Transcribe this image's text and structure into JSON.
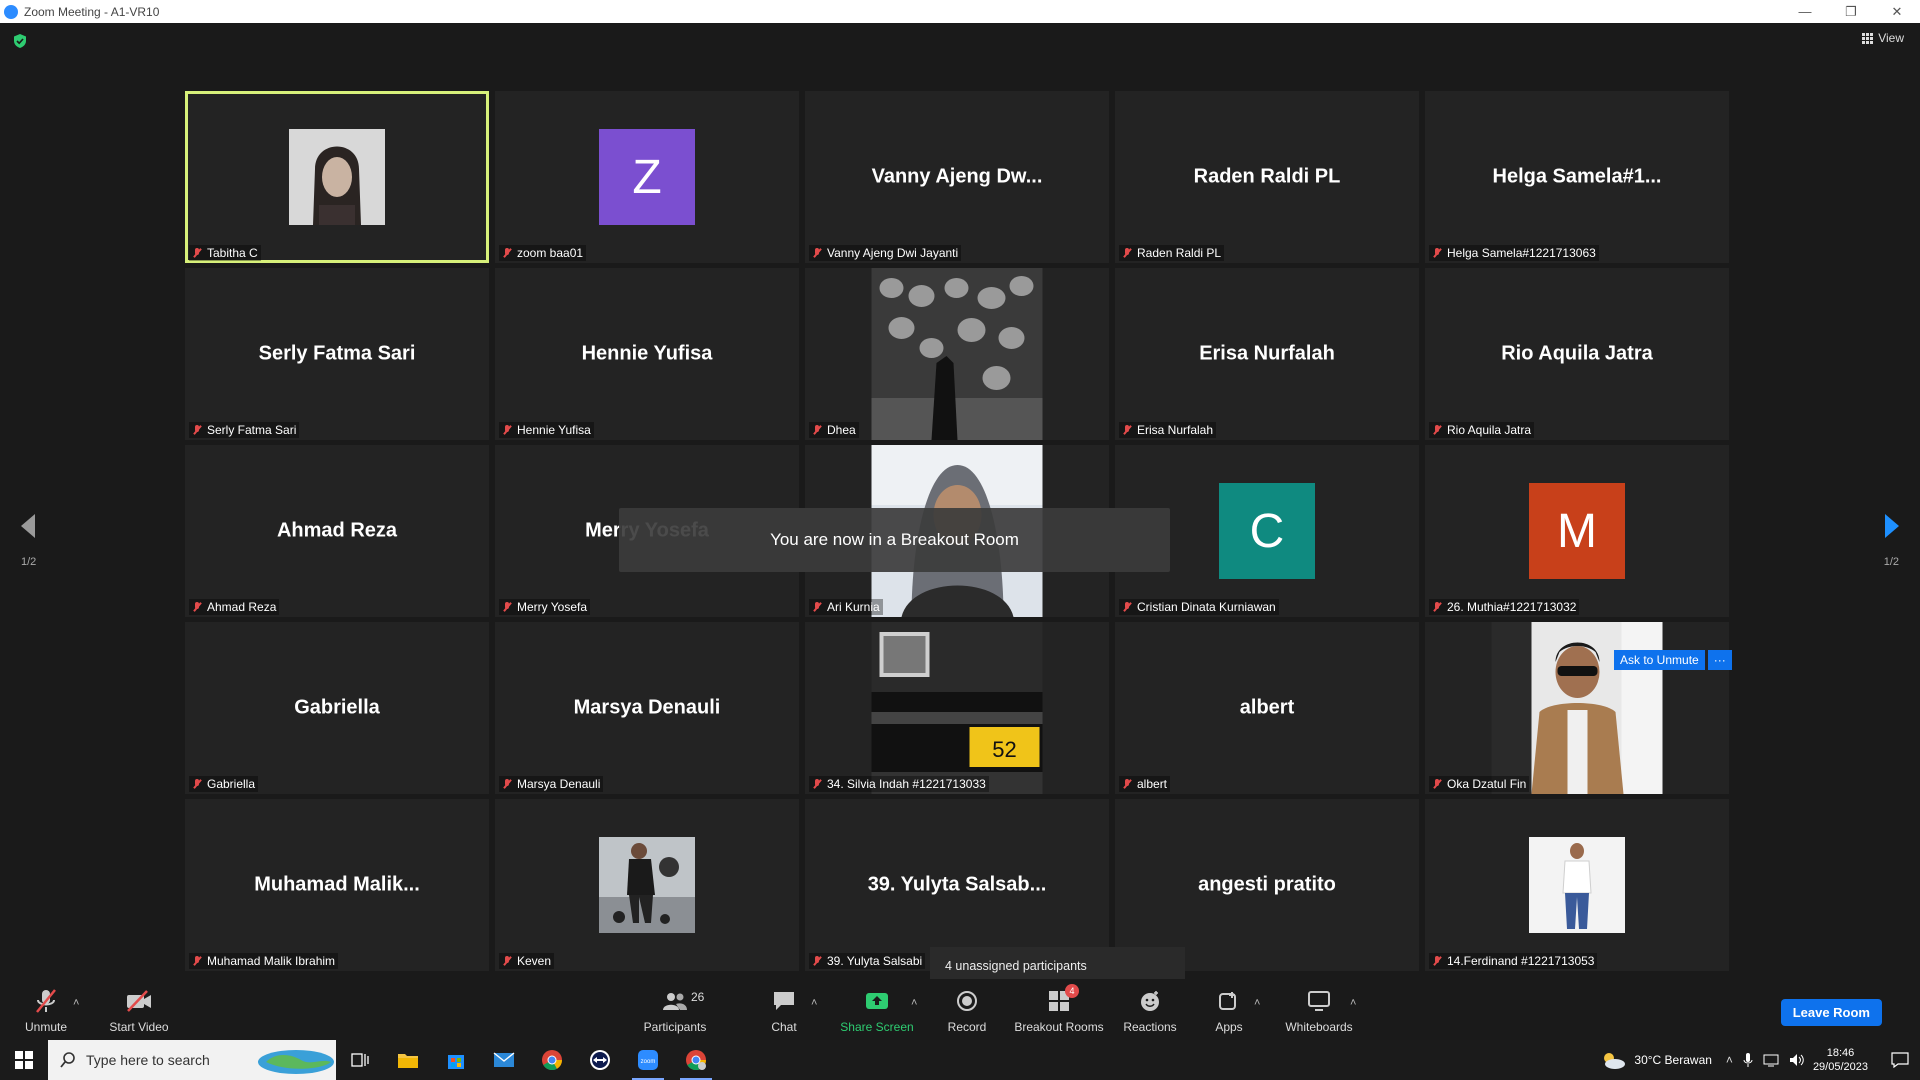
{
  "window": {
    "title": "Zoom Meeting - A1-VR10",
    "minimize": "—",
    "restore": "❐",
    "close": "✕"
  },
  "header": {
    "view_label": "View"
  },
  "tiles": [
    {
      "big": "",
      "label": "Tabitha C",
      "kind": "photo",
      "photo": "portrait"
    },
    {
      "big": "",
      "label": "zoom baa01",
      "kind": "avatar",
      "letter": "Z",
      "color": "#7b4fd0"
    },
    {
      "big": "Vanny  Ajeng  Dw...",
      "label": "Vanny Ajeng Dwi Jayanti",
      "kind": "name"
    },
    {
      "big": "Raden Raldi PL",
      "label": "Raden Raldi PL",
      "kind": "name"
    },
    {
      "big": "Helga  Samela#1...",
      "label": "Helga Samela#1221713063",
      "kind": "name"
    },
    {
      "big": "Serly Fatma Sari",
      "label": "Serly Fatma Sari",
      "kind": "name"
    },
    {
      "big": "Hennie Yufisa",
      "label": "Hennie Yufisa",
      "kind": "name"
    },
    {
      "big": "",
      "label": "Dhea",
      "kind": "photo",
      "photo": "lanterns"
    },
    {
      "big": "Erisa Nurfalah",
      "label": "Erisa Nurfalah",
      "kind": "name"
    },
    {
      "big": "Rio Aquila Jatra",
      "label": "Rio Aquila Jatra",
      "kind": "name"
    },
    {
      "big": "Ahmad Reza",
      "label": "Ahmad Reza",
      "kind": "name"
    },
    {
      "big": "Merry Yosefa",
      "label": "Merry Yosefa",
      "kind": "name"
    },
    {
      "big": "",
      "label": "Ari Kurnia",
      "kind": "photo",
      "photo": "hijab"
    },
    {
      "big": "",
      "label": "Cristian Dinata Kurniawan",
      "kind": "avatar",
      "letter": "C",
      "color": "#0f8a80"
    },
    {
      "big": "",
      "label": "26. Muthia#1221713032",
      "kind": "avatar",
      "letter": "M",
      "color": "#c8401a"
    },
    {
      "big": "Gabriella",
      "label": "Gabriella",
      "kind": "name"
    },
    {
      "big": "Marsya Denauli",
      "label": "Marsya Denauli",
      "kind": "name"
    },
    {
      "big": "",
      "label": "34. Silvia Indah #1221713033",
      "kind": "photo",
      "photo": "car"
    },
    {
      "big": "albert",
      "label": "albert",
      "kind": "name"
    },
    {
      "big": "",
      "label": "Oka Dzatul Fin",
      "kind": "photo",
      "photo": "man"
    },
    {
      "big": "Muhamad  Malik...",
      "label": "Muhamad Malik Ibrahim",
      "kind": "name"
    },
    {
      "big": "",
      "label": "Keven",
      "kind": "photo",
      "photo": "gym"
    },
    {
      "big": "39. Yulyta  Salsab...",
      "label": "39. Yulyta Salsabi",
      "kind": "name"
    },
    {
      "big": "angesti pratito",
      "label": "pratito",
      "kind": "name"
    },
    {
      "big": "",
      "label": "14.Ferdinand #1221713053",
      "kind": "photo",
      "photo": "standing"
    }
  ],
  "navigation": {
    "left_page": "1/2",
    "right_page": "1/2"
  },
  "toast": {
    "message": "You are now in a Breakout Room"
  },
  "ask_unmute": {
    "label": "Ask to Unmute",
    "more": "···"
  },
  "unassigned": {
    "text": "4 unassigned participants"
  },
  "toolbar": {
    "unmute": "Unmute",
    "start_video": "Start Video",
    "participants": "Participants",
    "participants_count": "26",
    "chat": "Chat",
    "share_screen": "Share Screen",
    "record": "Record",
    "breakout_rooms": "Breakout Rooms",
    "breakout_badge": "4",
    "reactions": "Reactions",
    "apps": "Apps",
    "whiteboards": "Whiteboards",
    "leave": "Leave Room",
    "caret": "˄"
  },
  "taskbar": {
    "search_placeholder": "Type here to search",
    "weather": "30°C  Berawan",
    "time": "18:46",
    "date": "29/05/2023"
  },
  "colors": {
    "active_outline": "#d7f07a",
    "accent": "#0e72ed",
    "share_green": "#2ecc71",
    "mute_red": "#e34b4b"
  }
}
